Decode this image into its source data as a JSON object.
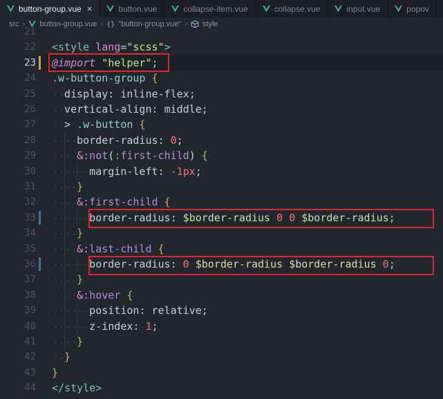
{
  "tabs": [
    {
      "label": "button-group.vue",
      "active": true,
      "closable": true
    },
    {
      "label": "button.vue"
    },
    {
      "label": "collapse-item.vue"
    },
    {
      "label": "collapse.vue"
    },
    {
      "label": "input.vue"
    },
    {
      "label": "popov"
    }
  ],
  "breadcrumb": {
    "folder": "src",
    "file": "button-group.vue",
    "section": "\"button-group.vue\"",
    "symbol": "style"
  },
  "editor": {
    "current_line": 23,
    "line_numbers": [
      "21",
      "22",
      "23",
      "24",
      "25",
      "26",
      "27",
      "28",
      "29",
      "30",
      "31",
      "32",
      "33",
      "34",
      "35",
      "36",
      "37",
      "38",
      "39",
      "40",
      "41",
      "42",
      "43",
      "44"
    ],
    "lines": [
      [],
      [
        {
          "t": "<",
          "c": "t-tag"
        },
        {
          "t": "style",
          "c": "t-tag"
        },
        {
          "t": " lang",
          "c": "t-attr"
        },
        {
          "t": "=",
          "c": "t-punc"
        },
        {
          "t": "\"scss\"",
          "c": "t-str"
        },
        {
          "t": ">",
          "c": "t-tag"
        }
      ],
      [
        {
          "t": "@import",
          "c": "t-kw"
        },
        {
          "t": " ",
          "c": "t-punc"
        },
        {
          "t": "\"helper\"",
          "c": "t-str"
        },
        {
          "t": ";",
          "c": "t-punc"
        }
      ],
      [
        {
          "t": ".w-button-group",
          "c": "t-sel"
        },
        {
          "t": " {",
          "c": "t-brace"
        }
      ],
      [
        {
          "t": "  display",
          "c": "t-prop"
        },
        {
          "t": ": ",
          "c": "t-punc"
        },
        {
          "t": "inline-flex",
          "c": "t-val"
        },
        {
          "t": ";",
          "c": "t-punc"
        }
      ],
      [
        {
          "t": "  vertical-align",
          "c": "t-prop"
        },
        {
          "t": ": ",
          "c": "t-punc"
        },
        {
          "t": "middle",
          "c": "t-val"
        },
        {
          "t": ";",
          "c": "t-punc"
        }
      ],
      [
        {
          "t": "  > ",
          "c": "t-punc"
        },
        {
          "t": ".w-button",
          "c": "t-sel"
        },
        {
          "t": " {",
          "c": "t-brace"
        }
      ],
      [
        {
          "t": "    border-radius",
          "c": "t-prop"
        },
        {
          "t": ": ",
          "c": "t-punc"
        },
        {
          "t": "0",
          "c": "t-num"
        },
        {
          "t": ";",
          "c": "t-punc"
        }
      ],
      [
        {
          "t": "    &",
          "c": "t-amp"
        },
        {
          "t": ":not",
          "c": "t-pseudo"
        },
        {
          "t": "(",
          "c": "t-punc"
        },
        {
          "t": ":first-child",
          "c": "t-pseudo"
        },
        {
          "t": ")",
          "c": "t-punc"
        },
        {
          "t": " {",
          "c": "t-brace"
        }
      ],
      [
        {
          "t": "      margin-left",
          "c": "t-prop"
        },
        {
          "t": ": ",
          "c": "t-punc"
        },
        {
          "t": "-1px",
          "c": "t-num"
        },
        {
          "t": ";",
          "c": "t-punc"
        }
      ],
      [
        {
          "t": "    }",
          "c": "t-brace"
        }
      ],
      [
        {
          "t": "    &",
          "c": "t-amp"
        },
        {
          "t": ":first-child",
          "c": "t-pseudo"
        },
        {
          "t": " {",
          "c": "t-brace"
        }
      ],
      [
        {
          "t": "      border-radius",
          "c": "t-prop"
        },
        {
          "t": ": ",
          "c": "t-punc"
        },
        {
          "t": "$border-radius",
          "c": "t-var"
        },
        {
          "t": " ",
          "c": "t-punc"
        },
        {
          "t": "0",
          "c": "t-num"
        },
        {
          "t": " ",
          "c": "t-punc"
        },
        {
          "t": "0",
          "c": "t-num"
        },
        {
          "t": " ",
          "c": "t-punc"
        },
        {
          "t": "$border-radius",
          "c": "t-var"
        },
        {
          "t": ";",
          "c": "t-punc"
        }
      ],
      [
        {
          "t": "    }",
          "c": "t-brace"
        }
      ],
      [
        {
          "t": "    &",
          "c": "t-amp"
        },
        {
          "t": ":last-child",
          "c": "t-pseudo"
        },
        {
          "t": " {",
          "c": "t-brace"
        }
      ],
      [
        {
          "t": "      border-radius",
          "c": "t-prop"
        },
        {
          "t": ": ",
          "c": "t-punc"
        },
        {
          "t": "0",
          "c": "t-num"
        },
        {
          "t": " ",
          "c": "t-punc"
        },
        {
          "t": "$border-radius",
          "c": "t-var"
        },
        {
          "t": " ",
          "c": "t-punc"
        },
        {
          "t": "$border-radius",
          "c": "t-var"
        },
        {
          "t": " ",
          "c": "t-punc"
        },
        {
          "t": "0",
          "c": "t-num"
        },
        {
          "t": ";",
          "c": "t-punc"
        }
      ],
      [
        {
          "t": "    }",
          "c": "t-brace"
        }
      ],
      [
        {
          "t": "    &",
          "c": "t-amp"
        },
        {
          "t": ":hover",
          "c": "t-pseudo"
        },
        {
          "t": " {",
          "c": "t-brace"
        }
      ],
      [
        {
          "t": "      position",
          "c": "t-prop"
        },
        {
          "t": ": ",
          "c": "t-punc"
        },
        {
          "t": "relative",
          "c": "t-val"
        },
        {
          "t": ";",
          "c": "t-punc"
        }
      ],
      [
        {
          "t": "      z-index",
          "c": "t-prop"
        },
        {
          "t": ": ",
          "c": "t-punc"
        },
        {
          "t": "1",
          "c": "t-num"
        },
        {
          "t": ";",
          "c": "t-punc"
        }
      ],
      [
        {
          "t": "    }",
          "c": "t-brace"
        }
      ],
      [
        {
          "t": "  }",
          "c": "t-brace"
        }
      ],
      [
        {
          "t": "}",
          "c": "t-brace"
        }
      ],
      [
        {
          "t": "</",
          "c": "t-tag"
        },
        {
          "t": "style",
          "c": "t-tag"
        },
        {
          "t": ">",
          "c": "t-tag"
        }
      ]
    ]
  },
  "colors": {
    "editor_bg": "#22272e",
    "highlight_box": "#e0262a",
    "vue_icon": "#41b883",
    "modified_marker": "#c9a24a"
  }
}
